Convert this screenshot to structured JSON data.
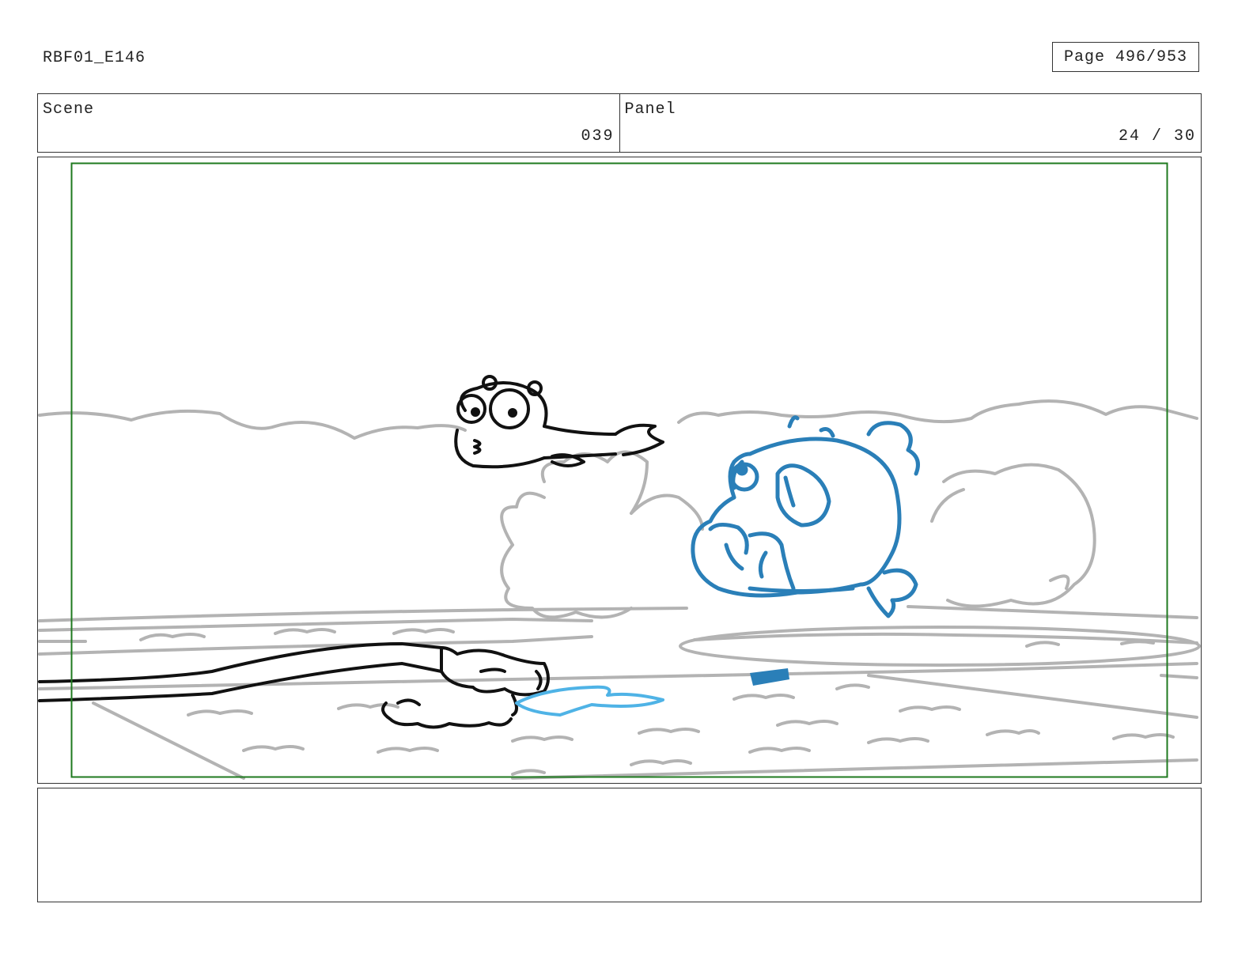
{
  "header": {
    "project_code": "RBF01_E146",
    "page_indicator": "Page 496/953"
  },
  "info": {
    "scene_label": "Scene",
    "scene_value": "039",
    "panel_label": "Panel",
    "panel_value": "24 / 30"
  },
  "colors": {
    "safe_frame": "#1f7a1f",
    "background_lines": "#b3b3b3",
    "character_lines": "#111111",
    "blue_character": "#2a7fb8",
    "puddle": "#4fb3e6"
  }
}
